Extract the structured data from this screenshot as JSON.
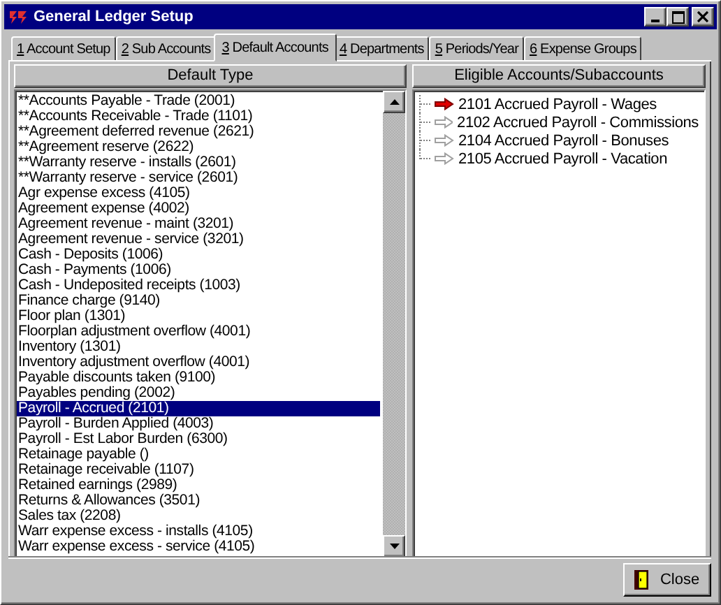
{
  "window": {
    "title": "General Ledger Setup"
  },
  "tabs": [
    {
      "key": "1",
      "label": "Account Setup",
      "selected": false
    },
    {
      "key": "2",
      "label": "Sub Accounts",
      "selected": false
    },
    {
      "key": "3",
      "label": "Default Accounts",
      "selected": true
    },
    {
      "key": "4",
      "label": "Departments",
      "selected": false
    },
    {
      "key": "5",
      "label": "Periods/Year",
      "selected": false
    },
    {
      "key": "6",
      "label": "Expense Groups",
      "selected": false
    }
  ],
  "default_types": {
    "header": "Default Type",
    "items": [
      {
        "label": "**Accounts Payable - Trade (2001)",
        "selected": false
      },
      {
        "label": "**Accounts Receivable - Trade (1101)",
        "selected": false
      },
      {
        "label": "**Agreement deferred revenue (2621)",
        "selected": false
      },
      {
        "label": "**Agreement reserve (2622)",
        "selected": false
      },
      {
        "label": "**Warranty reserve - installs (2601)",
        "selected": false
      },
      {
        "label": "**Warranty reserve - service (2601)",
        "selected": false
      },
      {
        "label": "Agr expense excess (4105)",
        "selected": false
      },
      {
        "label": "Agreement expense (4002)",
        "selected": false
      },
      {
        "label": "Agreement revenue - maint (3201)",
        "selected": false
      },
      {
        "label": "Agreement revenue - service (3201)",
        "selected": false
      },
      {
        "label": "Cash - Deposits (1006)",
        "selected": false
      },
      {
        "label": "Cash - Payments (1006)",
        "selected": false
      },
      {
        "label": "Cash - Undeposited receipts (1003)",
        "selected": false
      },
      {
        "label": "Finance charge (9140)",
        "selected": false
      },
      {
        "label": "Floor plan (1301)",
        "selected": false
      },
      {
        "label": "Floorplan adjustment overflow (4001)",
        "selected": false
      },
      {
        "label": "Inventory (1301)",
        "selected": false
      },
      {
        "label": "Inventory adjustment overflow (4001)",
        "selected": false
      },
      {
        "label": "Payable discounts taken (9100)",
        "selected": false
      },
      {
        "label": "Payables pending (2002)",
        "selected": false
      },
      {
        "label": "Payroll - Accrued (2101)",
        "selected": true
      },
      {
        "label": "Payroll - Burden Applied (4003)",
        "selected": false
      },
      {
        "label": "Payroll - Est Labor Burden (6300)",
        "selected": false
      },
      {
        "label": "Retainage payable ()",
        "selected": false
      },
      {
        "label": "Retainage receivable (1107)",
        "selected": false
      },
      {
        "label": "Retained earnings (2989)",
        "selected": false
      },
      {
        "label": "Returns & Allowances (3501)",
        "selected": false
      },
      {
        "label": "Sales tax (2208)",
        "selected": false
      },
      {
        "label": "Warr expense excess - installs (4105)",
        "selected": false
      },
      {
        "label": "Warr expense excess - service (4105)",
        "selected": false
      }
    ]
  },
  "eligible_accounts": {
    "header": "Eligible Accounts/Subaccounts",
    "items": [
      {
        "label": "2101 Accrued Payroll - Wages",
        "selected": true
      },
      {
        "label": "2102 Accrued Payroll - Commissions",
        "selected": false
      },
      {
        "label": "2104 Accrued Payroll - Bonuses",
        "selected": false
      },
      {
        "label": "2105 Accrued Payroll - Vacation",
        "selected": false
      }
    ]
  },
  "buttons": [
    {
      "label": "Close"
    }
  ]
}
